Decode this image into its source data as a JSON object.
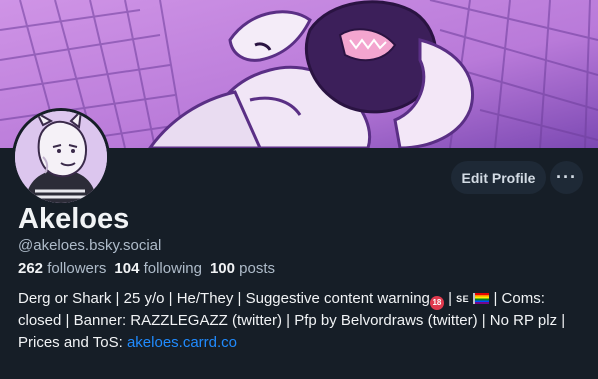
{
  "profile": {
    "display_name": "Akeloes",
    "handle": "@akeloes.bsky.social",
    "stats": {
      "followers_count": "262",
      "followers_label": "followers",
      "following_count": "104",
      "following_label": "following",
      "posts_count": "100",
      "posts_label": "posts"
    },
    "bio": {
      "part1": "Derg or Shark | 25 y/o | He/They | Suggestive content warning",
      "emoji_18": "18",
      "sep1": " | ",
      "emoji_se": "SE",
      "sep2": " ",
      "part2": " | Coms: closed | Banner: RAZZLEGAZZ (twitter) | Pfp by Belvordraws (twitter)  | No RP plz | Prices and ToS: ",
      "link": "akeloes.carrd.co"
    }
  },
  "actions": {
    "edit_profile_label": "Edit Profile",
    "more_label": "···"
  },
  "colors": {
    "background": "#161e27",
    "banner_purple": "#b678d6",
    "link": "#208bfe",
    "muted_text": "#aebbc9",
    "button_bg": "#1e2936"
  },
  "icons": {
    "more": "ellipsis-icon",
    "emoji_18": "no-under-18-icon",
    "emoji_flag": "rainbow-flag-icon"
  }
}
